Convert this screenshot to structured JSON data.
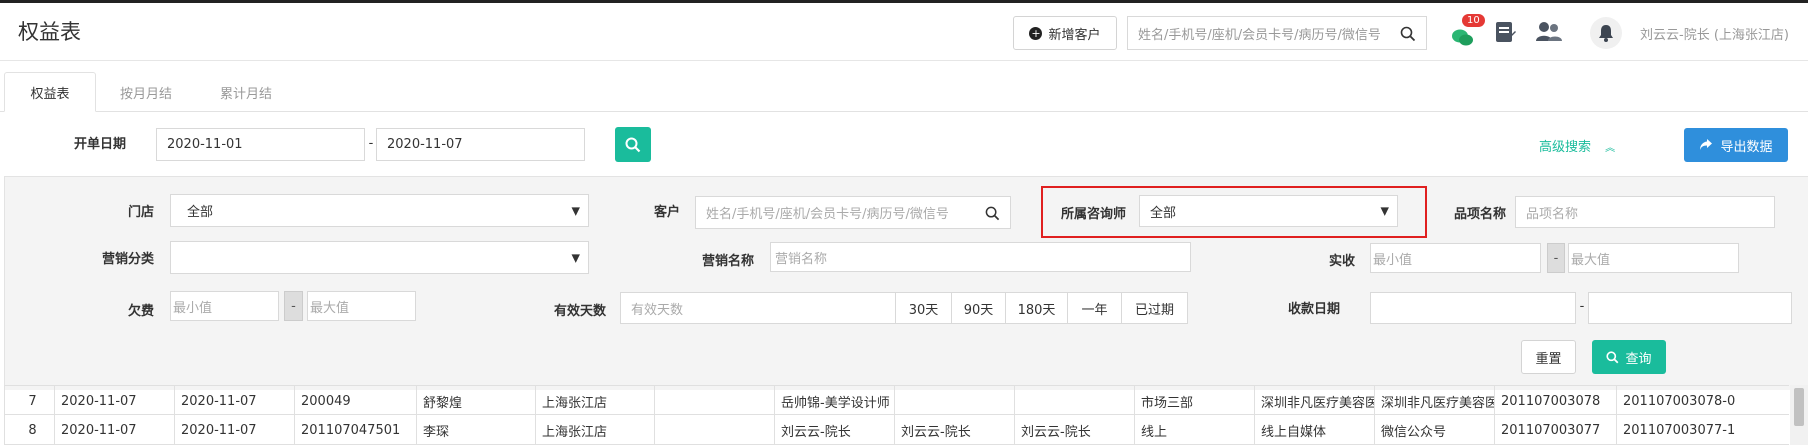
{
  "header": {
    "title": "权益表",
    "add_customer_label": "新增客户",
    "search_placeholder": "姓名/手机号/座机/会员卡号/病历号/微信号",
    "message_badge": "10",
    "user_label": "刘云云-院长 (上海张江店)"
  },
  "tabs": [
    {
      "label": "权益表",
      "active": true
    },
    {
      "label": "按月月结",
      "active": false
    },
    {
      "label": "累计月结",
      "active": false
    }
  ],
  "date_filter": {
    "label": "开单日期",
    "start": "2020-11-01",
    "separator": "-",
    "end": "2020-11-07"
  },
  "actions": {
    "advanced_search_label": "高级搜索",
    "export_label": "导出数据"
  },
  "filters": {
    "store": {
      "label": "门店",
      "value": "全部"
    },
    "customer": {
      "label": "客户",
      "placeholder": "姓名/手机号/座机/会员卡号/病历号/微信号"
    },
    "consultant": {
      "label": "所属咨询师",
      "value": "全部"
    },
    "item_name": {
      "label": "品项名称",
      "placeholder": "品项名称"
    },
    "marketing_category": {
      "label": "营销分类",
      "value": ""
    },
    "marketing_name": {
      "label": "营销名称",
      "placeholder": "营销名称"
    },
    "actual_received": {
      "label": "实收",
      "min_placeholder": "最小值",
      "max_placeholder": "最大值",
      "separator": "-"
    },
    "arrears": {
      "label": "欠费",
      "min_placeholder": "最小值",
      "max_placeholder": "最大值",
      "separator": "-"
    },
    "valid_days": {
      "label": "有效天数",
      "placeholder": "有效天数",
      "options": [
        "30天",
        "90天",
        "180天",
        "一年",
        "已过期"
      ]
    },
    "payment_date": {
      "label": "收款日期",
      "separator": "-"
    },
    "reset_label": "重置",
    "query_label": "查询"
  },
  "table": {
    "rows": [
      [
        "7",
        "2020-11-07",
        "2020-11-07",
        "200049",
        "舒黎煌",
        "上海张江店",
        "",
        "岳帅锦-美学设计师",
        "",
        "",
        "市场三部",
        "深圳非凡医疗美容医",
        "深圳非凡医疗美容医",
        "201107003078",
        "201107003078-0"
      ],
      [
        "8",
        "2020-11-07",
        "2020-11-07",
        "201107047501",
        "李琛",
        "上海张江店",
        "",
        "刘云云-院长",
        "刘云云-院长",
        "刘云云-院长",
        "线上",
        "线上自媒体",
        "微信公众号",
        "201107003077",
        "201107003077-1"
      ]
    ]
  },
  "colors": {
    "teal": "#1abc9c",
    "blue": "#2f8fdc",
    "highlight_red": "#e02020",
    "advanced_green": "#1abc9c"
  }
}
